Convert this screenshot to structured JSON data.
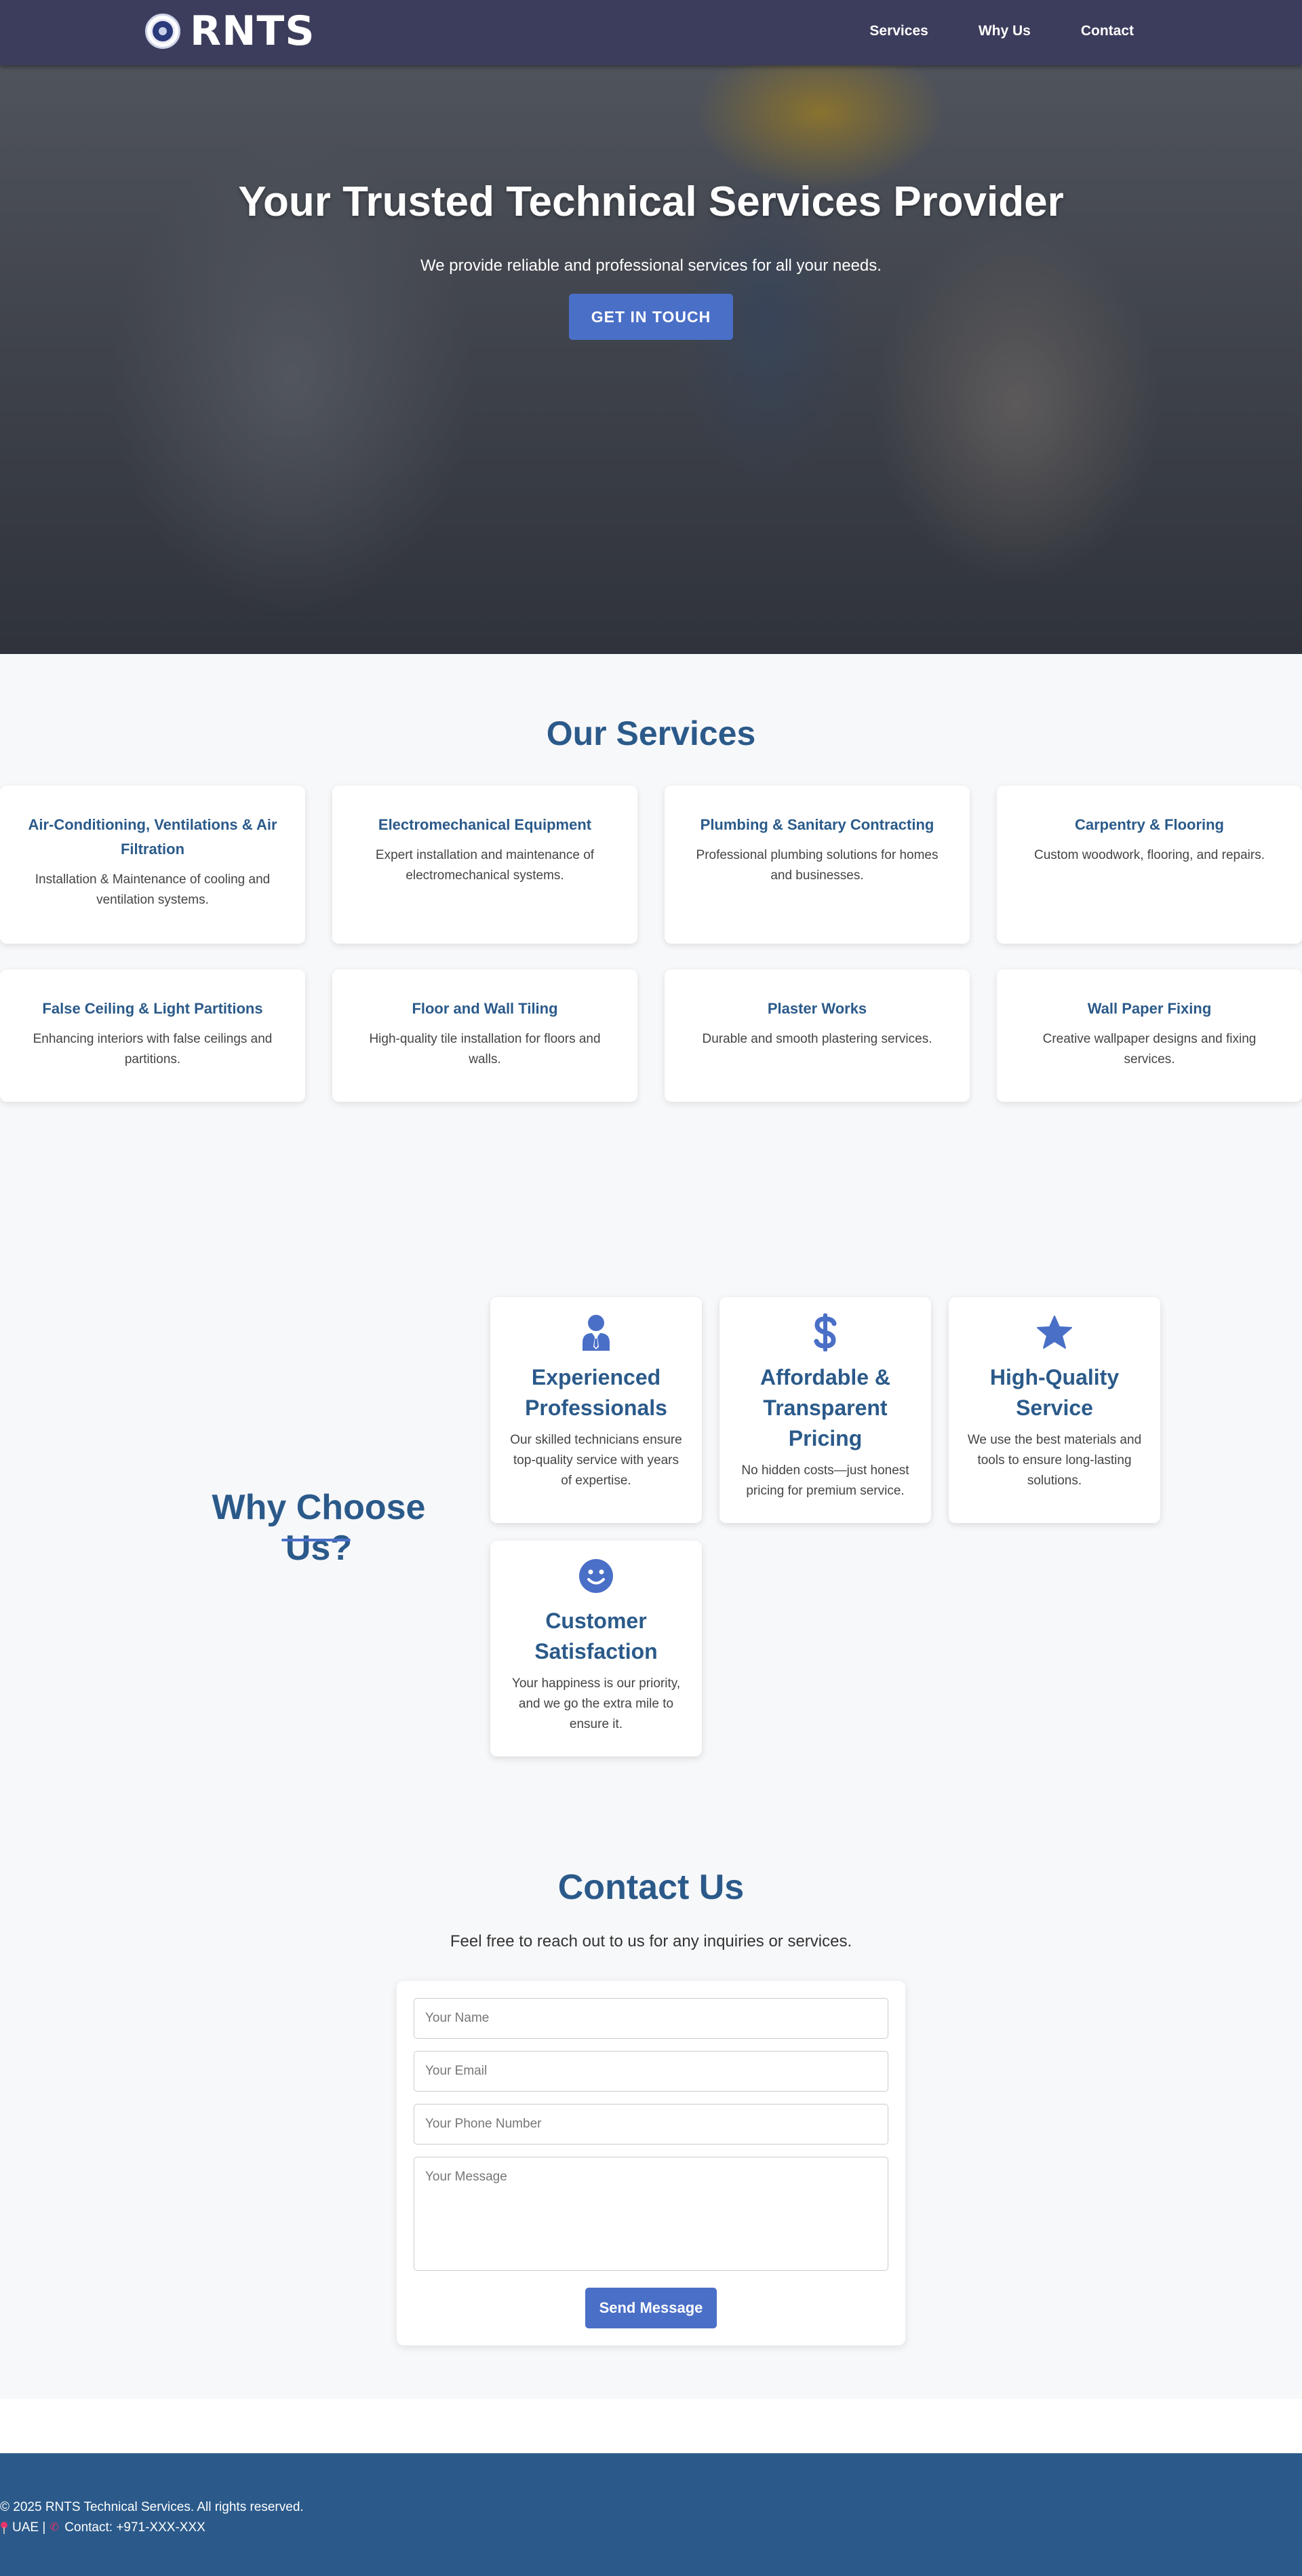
{
  "brand": {
    "name": "RNTS"
  },
  "nav": {
    "items": [
      "Services",
      "Why Us",
      "Contact"
    ]
  },
  "hero": {
    "title": "Your Trusted Technical Services Provider",
    "subtitle": "We provide reliable and professional services for all your needs.",
    "cta": "GET IN TOUCH"
  },
  "services": {
    "title": "Our Services",
    "items": [
      {
        "title": "Air-Conditioning, Ventilations & Air Filtration",
        "desc": "Installation & Maintenance of cooling and ventilation systems."
      },
      {
        "title": "Electromechanical Equipment",
        "desc": "Expert installation and maintenance of electromechanical systems."
      },
      {
        "title": "Plumbing & Sanitary Contracting",
        "desc": "Professional plumbing solutions for homes and businesses."
      },
      {
        "title": "Carpentry & Flooring",
        "desc": "Custom woodwork, flooring, and repairs."
      },
      {
        "title": "False Ceiling & Light Partitions",
        "desc": "Enhancing interiors with false ceilings and partitions."
      },
      {
        "title": "Floor and Wall Tiling",
        "desc": "High-quality tile installation for floors and walls."
      },
      {
        "title": "Plaster Works",
        "desc": "Durable and smooth plastering services."
      },
      {
        "title": "Wall Paper Fixing",
        "desc": "Creative wallpaper designs and fixing services."
      }
    ]
  },
  "why": {
    "title": "Why Choose Us?",
    "items": [
      {
        "icon": "user-tie-icon",
        "title": "Experienced Professionals",
        "desc": "Our skilled technicians ensure top-quality service with years of expertise."
      },
      {
        "icon": "dollar-icon",
        "title": "Affordable & Transparent Pricing",
        "desc": "No hidden costs—just honest pricing for premium service."
      },
      {
        "icon": "star-icon",
        "title": "High-Quality Service",
        "desc": "We use the best materials and tools to ensure long-lasting solutions."
      },
      {
        "icon": "smile-icon",
        "title": "Customer Satisfaction",
        "desc": "Your happiness is our priority, and we go the extra mile to ensure it."
      }
    ],
    "accent": "#4a6fc7"
  },
  "contact": {
    "title": "Contact Us",
    "subtitle": "Feel free to reach out to us for any inquiries or services.",
    "name_placeholder": "Your Name",
    "email_placeholder": "Your Email",
    "phone_placeholder": "Your Phone Number",
    "message_placeholder": "Your Message",
    "submit": "Send Message"
  },
  "footer": {
    "copyright": "© 2025 RNTS Technical Services. All rights reserved.",
    "location": "UAE |",
    "contact": "Contact: +971-XXX-XXX"
  },
  "colors": {
    "nav_bg": "#3c3c5c",
    "heading": "#2b5a8a",
    "accent": "#4a6fc7",
    "footer_bg": "#2b5a8a"
  }
}
